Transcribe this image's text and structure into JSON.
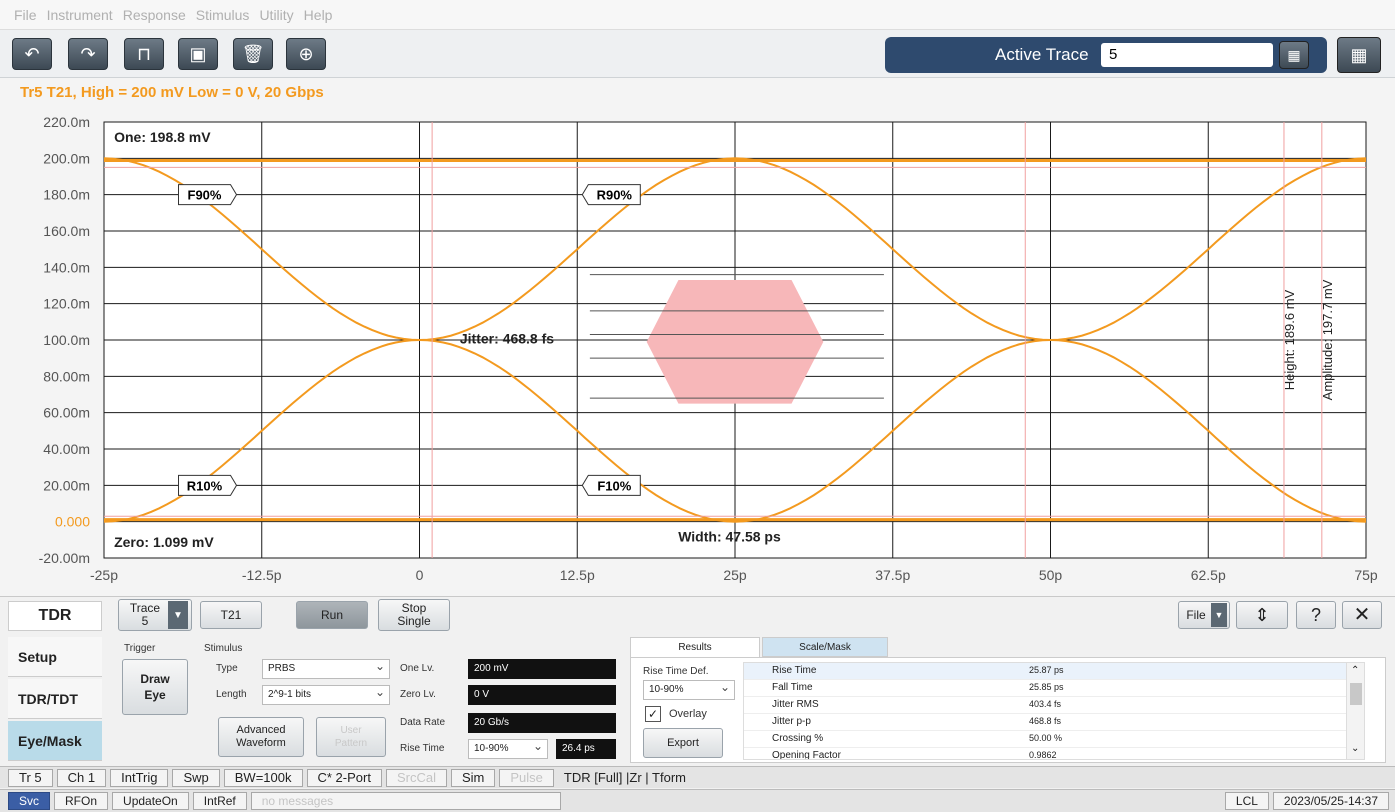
{
  "menu": [
    "File",
    "Instrument",
    "Response",
    "Stimulus",
    "Utility",
    "Help"
  ],
  "toolbar": {
    "buttons": [
      "undo-icon",
      "redo-icon",
      "pulse-icon",
      "capture-icon",
      "trash-icon",
      "zoom-in-icon"
    ],
    "active_trace_label": "Active Trace",
    "active_trace_value": "5"
  },
  "trace_title": "Tr5 T21, High = 200 mV Low = 0 V, 20 Gbps",
  "chart_data": {
    "type": "line",
    "title": "Tr5 T21, High = 200 mV Low = 0 V, 20 Gbps",
    "x_ticks": [
      "-25p",
      "-12.5p",
      "0",
      "12.5p",
      "25p",
      "37.5p",
      "50p",
      "62.5p",
      "75p"
    ],
    "y_ticks": [
      "220.0m",
      "200.0m",
      "180.0m",
      "160.0m",
      "140.0m",
      "120.0m",
      "100.0m",
      "80.00m",
      "60.00m",
      "40.00m",
      "20.00m",
      "0.000",
      "-20.00m"
    ],
    "xlim": [
      -25,
      75
    ],
    "ylim": [
      -20,
      220
    ],
    "x_unit": "ps",
    "y_unit": "mV",
    "series": [
      {
        "x": [
          -25,
          0,
          25,
          50,
          75
        ],
        "y": [
          200,
          100,
          0,
          100,
          200
        ]
      },
      {
        "x": [
          -25,
          0,
          25,
          50,
          75
        ],
        "y": [
          0,
          100,
          200,
          100,
          0
        ]
      }
    ],
    "crossings_ps": [
      0,
      50
    ],
    "one_level_mV": 198.8,
    "zero_level_mV": 1.099,
    "mask": {
      "x_range_ps": [
        18,
        32
      ],
      "y_range_mV": [
        65,
        133
      ]
    },
    "annotations": {
      "one": "One: 198.8 mV",
      "zero": "Zero: 1.099 mV",
      "jitter": "Jitter: 468.8 fs",
      "width": "Width: 47.58 ps",
      "height": "Height: 189.6 mV",
      "amplitude": "Amplitude: 197.7 mV",
      "f90": "F90%",
      "r90": "R90%",
      "r10": "R10%",
      "f10": "F10%"
    },
    "colors": {
      "trace": "#f39a1f",
      "mask": "#f7b7b9",
      "grid": "#1a1a1a"
    }
  },
  "bottom": {
    "mode_label": "TDR",
    "trace_btn": {
      "line1": "Trace",
      "line2": "5"
    },
    "t21": "T21",
    "run": "Run",
    "stop_single": {
      "line1": "Stop",
      "line2": "Single"
    },
    "file": "File",
    "help": "?",
    "close": "✕",
    "side_tabs": [
      "Setup",
      "TDR/TDT",
      "Eye/Mask"
    ],
    "trigger": {
      "label": "Trigger",
      "draw_eye": [
        "Draw",
        "Eye"
      ]
    },
    "stimulus": {
      "label": "Stimulus",
      "type_label": "Type",
      "type_value": "PRBS",
      "length_label": "Length",
      "length_value": "2^9-1 bits",
      "one_lv_label": "One Lv.",
      "one_lv_value": "200 mV",
      "zero_lv_label": "Zero Lv.",
      "zero_lv_value": "0 V",
      "data_rate_label": "Data Rate",
      "data_rate_value": "20 Gb/s",
      "rise_time_label": "Rise Time",
      "rise_time_mode": "10-90%",
      "rise_time_value": "26.4 ps",
      "advanced": [
        "Advanced",
        "Waveform"
      ],
      "user_pattern": [
        "User",
        "Pattern"
      ]
    },
    "results": {
      "tab_results": "Results",
      "tab_scale": "Scale/Mask",
      "rise_def_label": "Rise Time Def.",
      "rise_def_value": "10-90%",
      "overlay_label": "Overlay",
      "export_label": "Export",
      "rows": [
        {
          "name": "Rise Time",
          "value": "25.87 ps"
        },
        {
          "name": "Fall Time",
          "value": "25.85 ps"
        },
        {
          "name": "Jitter RMS",
          "value": "403.4 fs"
        },
        {
          "name": "Jitter p-p",
          "value": "468.8 fs"
        },
        {
          "name": "Crossing %",
          "value": "50.00 %"
        },
        {
          "name": "Opening Factor",
          "value": "0.9862"
        }
      ]
    }
  },
  "status1": [
    "Tr 5",
    "Ch 1",
    "IntTrig",
    "Swp",
    "BW=100k",
    "C* 2-Port",
    "SrcCal",
    "Sim",
    "Pulse",
    "TDR [Full] |Zr | Tform"
  ],
  "status2": {
    "items": [
      "Svc",
      "RFOn",
      "UpdateOn",
      "IntRef"
    ],
    "message": "no messages",
    "lcl": "LCL",
    "datetime": "2023/05/25-14:37"
  }
}
